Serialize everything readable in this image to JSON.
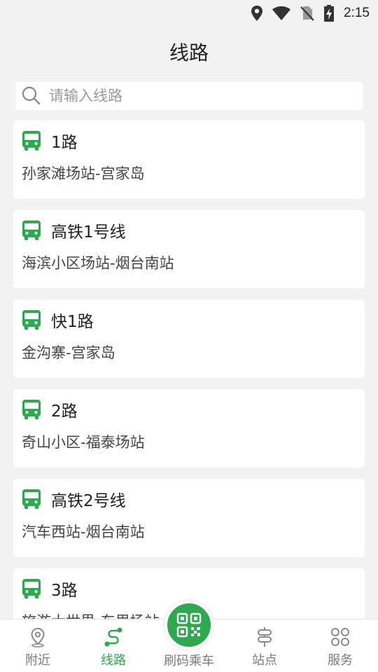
{
  "status_bar": {
    "time": "2:15",
    "icons": [
      "location-icon",
      "wifi-icon",
      "no-sim-icon",
      "battery-charging-icon"
    ]
  },
  "header": {
    "title": "线路"
  },
  "search": {
    "placeholder": "请输入线路",
    "value": ""
  },
  "routes": [
    {
      "name": "1路",
      "desc": "孙家滩场站-宫家岛"
    },
    {
      "name": "高铁1号线",
      "desc": "海滨小区场站-烟台南站"
    },
    {
      "name": "快1路",
      "desc": "金沟寨-宫家岛"
    },
    {
      "name": "2路",
      "desc": "奇山小区-福泰场站"
    },
    {
      "name": "高铁2号线",
      "desc": "汽车西站-烟台南站"
    },
    {
      "name": "3路",
      "desc": "旅游大世界-东里场站"
    }
  ],
  "bottom_nav": {
    "nearby": "附近",
    "routes": "线路",
    "scan": "刷码乘车",
    "stops": "站点",
    "services": "服务"
  },
  "colors": {
    "accent": "#2fa84f",
    "bus_icon": "#2fa84f",
    "inactive": "#7a7a7a"
  }
}
